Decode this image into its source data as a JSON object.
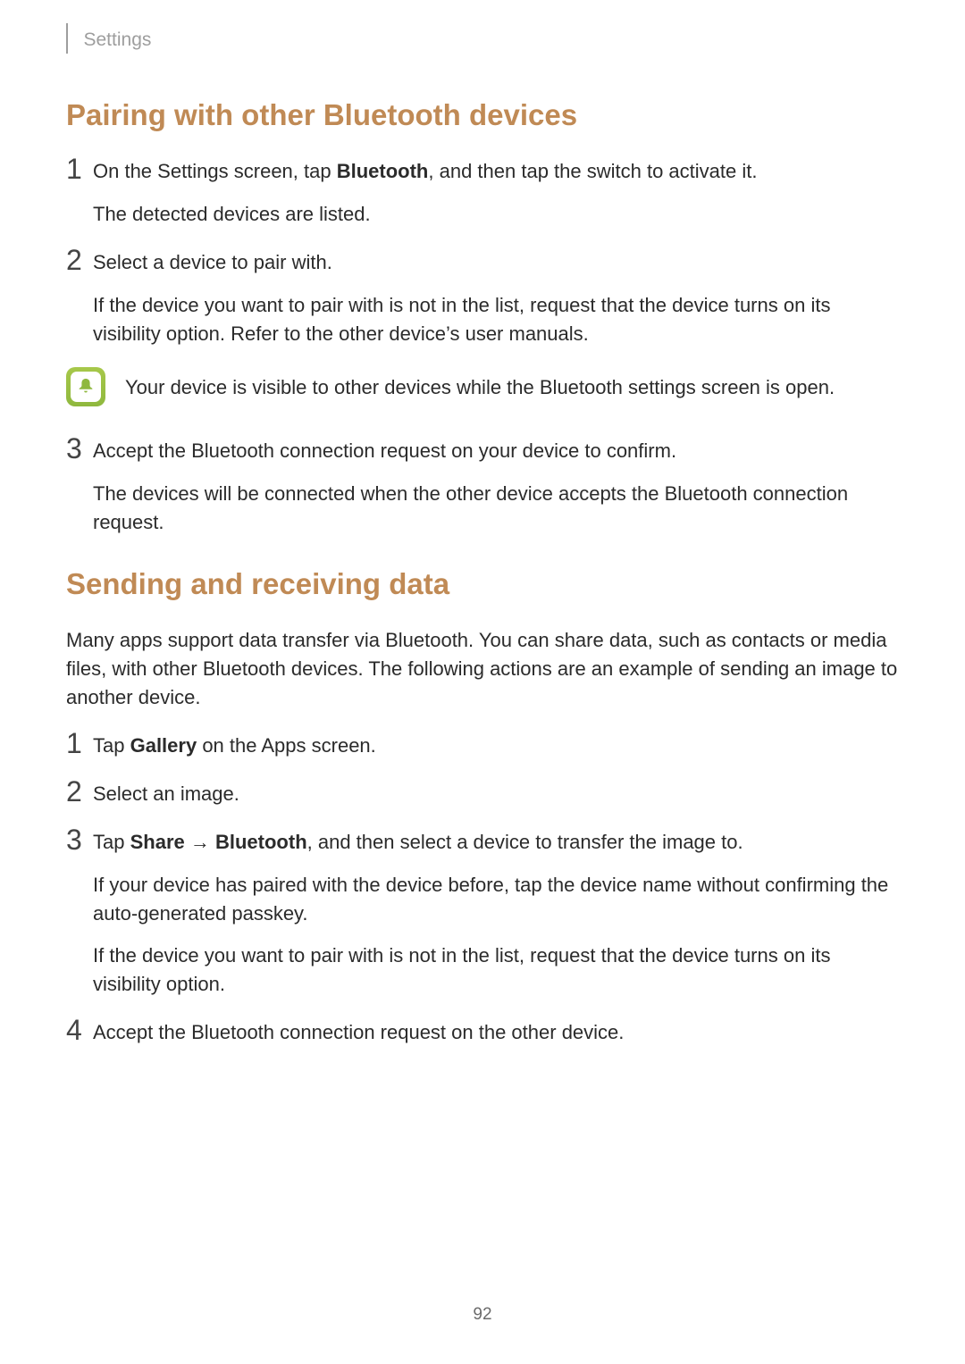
{
  "header": {
    "breadcrumb": "Settings"
  },
  "section1": {
    "title": "Pairing with other Bluetooth devices",
    "steps": [
      {
        "num": "1",
        "p1_pre": "On the Settings screen, tap ",
        "p1_bold": "Bluetooth",
        "p1_post": ", and then tap the switch to activate it.",
        "p2": "The detected devices are listed."
      },
      {
        "num": "2",
        "p1": "Select a device to pair with.",
        "p2": "If the device you want to pair with is not in the list, request that the device turns on its visibility option. Refer to the other device’s user manuals."
      },
      {
        "num": "3",
        "p1": "Accept the Bluetooth connection request on your device to confirm.",
        "p2": "The devices will be connected when the other device accepts the Bluetooth connection request."
      }
    ],
    "note": "Your device is visible to other devices while the Bluetooth settings screen is open."
  },
  "section2": {
    "title": "Sending and receiving data",
    "intro": "Many apps support data transfer via Bluetooth. You can share data, such as contacts or media files, with other Bluetooth devices. The following actions are an example of sending an image to another device.",
    "steps": [
      {
        "num": "1",
        "p1_pre": "Tap ",
        "p1_bold": "Gallery",
        "p1_post": " on the Apps screen."
      },
      {
        "num": "2",
        "p1": "Select an image."
      },
      {
        "num": "3",
        "p1_pre": "Tap ",
        "p1_bold1": "Share",
        "p1_arrow": " → ",
        "p1_bold2": "Bluetooth",
        "p1_post": ", and then select a device to transfer the image to.",
        "p2": "If your device has paired with the device before, tap the device name without confirming the auto-generated passkey.",
        "p3": "If the device you want to pair with is not in the list, request that the device turns on its visibility option."
      },
      {
        "num": "4",
        "p1": "Accept the Bluetooth connection request on the other device."
      }
    ]
  },
  "page_number": "92",
  "colors": {
    "accent": "#c08a55",
    "note_icon_bg": "#9ac344"
  }
}
